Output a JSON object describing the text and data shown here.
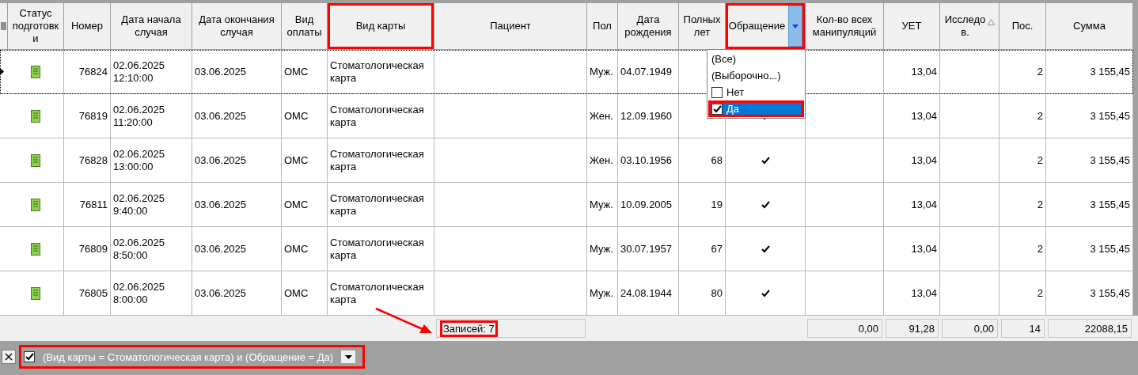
{
  "columns": [
    {
      "label": "Статус подготовки",
      "highlighted": false
    },
    {
      "label": "Номер",
      "highlighted": false
    },
    {
      "label": "Дата начала случая",
      "highlighted": false
    },
    {
      "label": "Дата окончания случая",
      "highlighted": false
    },
    {
      "label": "Вид оплаты",
      "highlighted": false
    },
    {
      "label": "Вид карты",
      "highlighted": true
    },
    {
      "label": "Пациент",
      "highlighted": false
    },
    {
      "label": "Пол",
      "highlighted": false
    },
    {
      "label": "Дата рождения",
      "highlighted": false
    },
    {
      "label": "Полных лет",
      "highlighted": false
    },
    {
      "label": "Обращение",
      "highlighted": true,
      "filter_active": true
    },
    {
      "label": "Кол-во всех манипуляций",
      "highlighted": false
    },
    {
      "label": "УЕТ",
      "highlighted": false
    },
    {
      "label": "Исследов.",
      "highlighted": false,
      "sorted": true
    },
    {
      "label": "Пос.",
      "highlighted": false
    },
    {
      "label": "Сумма",
      "highlighted": false
    }
  ],
  "rows": [
    {
      "current": true,
      "number": "76824",
      "start_date": "02.06.2025",
      "start_time": "12:10:00",
      "end_date": "03.06.2025",
      "payment": "ОМС",
      "card": "Стоматологическая карта",
      "sex": "Муж.",
      "birth": "04.07.1949",
      "uet": "13,04",
      "visits": "2",
      "sum": "3 155,45"
    },
    {
      "current": false,
      "number": "76819",
      "start_date": "02.06.2025",
      "start_time": "11:20:00",
      "end_date": "03.06.2025",
      "payment": "ОМС",
      "card": "Стоматологическая карта",
      "sex": "Жен.",
      "birth": "12.09.1960",
      "referral": true,
      "uet": "13,04",
      "visits": "2",
      "sum": "3 155,45"
    },
    {
      "current": false,
      "number": "76828",
      "start_date": "02.06.2025",
      "start_time": "13:00:00",
      "end_date": "03.06.2025",
      "payment": "ОМС",
      "card": "Стоматологическая карта",
      "sex": "Жен.",
      "birth": "03.10.1956",
      "age": "68",
      "referral": true,
      "uet": "13,04",
      "visits": "2",
      "sum": "3 155,45"
    },
    {
      "current": false,
      "number": "76811",
      "start_date": "02.06.2025",
      "start_time": "9:40:00",
      "end_date": "03.06.2025",
      "payment": "ОМС",
      "card": "Стоматологическая карта",
      "sex": "Муж.",
      "birth": "10.09.2005",
      "age": "19",
      "referral": true,
      "uet": "13,04",
      "visits": "2",
      "sum": "3 155,45"
    },
    {
      "current": false,
      "number": "76809",
      "start_date": "02.06.2025",
      "start_time": "8:50:00",
      "end_date": "03.06.2025",
      "payment": "ОМС",
      "card": "Стоматологическая карта",
      "sex": "Муж.",
      "birth": "30.07.1957",
      "age": "67",
      "referral": true,
      "uet": "13,04",
      "visits": "2",
      "sum": "3 155,45"
    },
    {
      "current": false,
      "number": "76805",
      "start_date": "02.06.2025",
      "start_time": "8:00:00",
      "end_date": "03.06.2025",
      "payment": "ОМС",
      "card": "Стоматологическая карта",
      "sex": "Муж.",
      "birth": "24.08.1944",
      "age": "80",
      "referral": true,
      "uet": "13,04",
      "visits": "2",
      "sum": "3 155,45"
    }
  ],
  "dropdown": {
    "items": [
      {
        "label": "(Все)",
        "kind": "special",
        "selected": false
      },
      {
        "label": "(Выборочно...)",
        "kind": "special",
        "selected": false
      },
      {
        "label": "Нет",
        "kind": "value",
        "checked": false,
        "selected": false,
        "highlighted": false
      },
      {
        "label": "Да",
        "kind": "value",
        "checked": true,
        "selected": true,
        "highlighted": true
      }
    ]
  },
  "footer": {
    "records": "Записей: 7",
    "records_highlighted": true,
    "totals": [
      "0,00",
      "91,28",
      "0,00",
      "14",
      "22088,15"
    ]
  },
  "filter_bar": {
    "enabled": true,
    "expression": "(Вид карты = Стоматологическая карта) и (Обращение = Да)",
    "highlighted": true
  }
}
